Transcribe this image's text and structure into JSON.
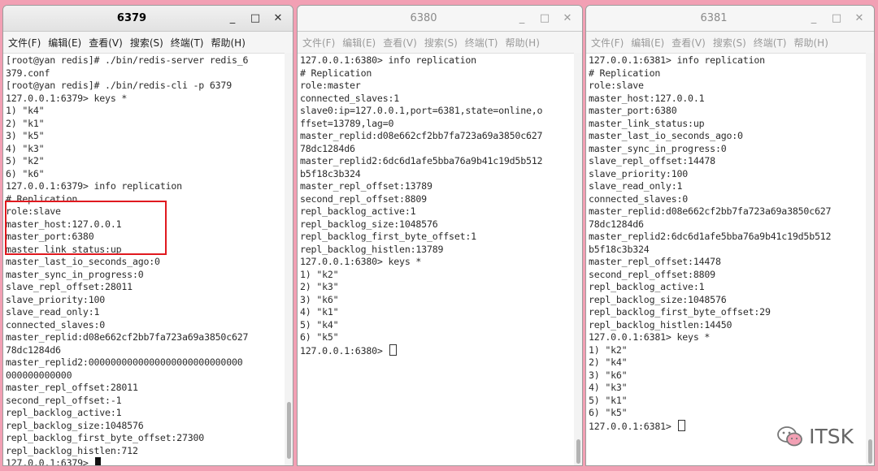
{
  "menu": [
    "文件(F)",
    "编辑(E)",
    "查看(V)",
    "搜索(S)",
    "终端(T)",
    "帮助(H)"
  ],
  "window_controls": {
    "minimize": "_",
    "maximize": "□",
    "close": "✕"
  },
  "windows": [
    {
      "title": "6379",
      "active": true,
      "lines": [
        "[root@yan redis]# ./bin/redis-server redis_6",
        "379.conf",
        "[root@yan redis]# ./bin/redis-cli -p 6379",
        "127.0.0.1:6379> keys *",
        "1) \"k4\"",
        "2) \"k1\"",
        "3) \"k5\"",
        "4) \"k3\"",
        "5) \"k2\"",
        "6) \"k6\"",
        "127.0.0.1:6379> info replication",
        "# Replication",
        "role:slave",
        "master_host:127.0.0.1",
        "master_port:6380",
        "master_link_status:up",
        "master_last_io_seconds_ago:0",
        "master_sync_in_progress:0",
        "slave_repl_offset:28011",
        "slave_priority:100",
        "slave_read_only:1",
        "connected_slaves:0",
        "master_replid:d08e662cf2bb7fa723a69a3850c627",
        "78dc1284d6",
        "master_replid2:0000000000000000000000000000",
        "000000000000",
        "master_repl_offset:28011",
        "second_repl_offset:-1",
        "repl_backlog_active:1",
        "repl_backlog_size:1048576",
        "repl_backlog_first_byte_offset:27300",
        "repl_backlog_histlen:712"
      ],
      "prompt": "127.0.0.1:6379> "
    },
    {
      "title": "6380",
      "active": false,
      "lines": [
        "127.0.0.1:6380> info replication",
        "# Replication",
        "role:master",
        "connected_slaves:1",
        "slave0:ip=127.0.0.1,port=6381,state=online,o",
        "ffset=13789,lag=0",
        "master_replid:d08e662cf2bb7fa723a69a3850c627",
        "78dc1284d6",
        "master_replid2:6dc6d1afe5bba76a9b41c19d5b512",
        "b5f18c3b324",
        "master_repl_offset:13789",
        "second_repl_offset:8809",
        "repl_backlog_active:1",
        "repl_backlog_size:1048576",
        "repl_backlog_first_byte_offset:1",
        "repl_backlog_histlen:13789",
        "127.0.0.1:6380> keys *",
        "1) \"k2\"",
        "2) \"k3\"",
        "3) \"k6\"",
        "4) \"k1\"",
        "5) \"k4\"",
        "6) \"k5\""
      ],
      "prompt": "127.0.0.1:6380> "
    },
    {
      "title": "6381",
      "active": false,
      "lines": [
        "127.0.0.1:6381> info replication",
        "# Replication",
        "role:slave",
        "master_host:127.0.0.1",
        "master_port:6380",
        "master_link_status:up",
        "master_last_io_seconds_ago:0",
        "master_sync_in_progress:0",
        "slave_repl_offset:14478",
        "slave_priority:100",
        "slave_read_only:1",
        "connected_slaves:0",
        "master_replid:d08e662cf2bb7fa723a69a3850c627",
        "78dc1284d6",
        "master_replid2:6dc6d1afe5bba76a9b41c19d5b512",
        "b5f18c3b324",
        "master_repl_offset:14478",
        "second_repl_offset:8809",
        "repl_backlog_active:1",
        "repl_backlog_size:1048576",
        "repl_backlog_first_byte_offset:29",
        "repl_backlog_histlen:14450",
        "127.0.0.1:6381> keys *",
        "1) \"k2\"",
        "2) \"k4\"",
        "3) \"k6\"",
        "4) \"k3\"",
        "5) \"k1\"",
        "6) \"k5\""
      ],
      "prompt": "127.0.0.1:6381> "
    }
  ],
  "watermark": "ITSK",
  "colors": {
    "desktop": "#f2a0b4",
    "highlight": "#e0191f"
  }
}
